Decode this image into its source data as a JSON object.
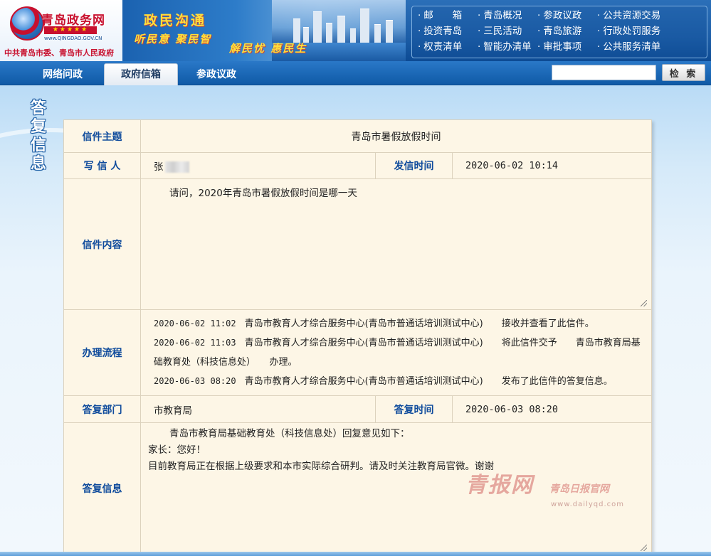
{
  "header": {
    "logo_title": "青岛政务网",
    "logo_stars": "★★★★★",
    "logo_domain": "www.QINGDAO.GOV.CN",
    "logo_subtitle": "中共青岛市委、青岛市人民政府",
    "slogan_main": "政民沟通",
    "slogan_line1": "听民意 聚民智",
    "slogan_line2": "解民忧 惠民生",
    "nav_links": [
      "邮　　箱",
      "青岛概况",
      "参政议政",
      "公共资源交易",
      "投资青岛",
      "三民活动",
      "青岛旅游",
      "行政处罚服务",
      "权责清单",
      "智能办清单",
      "审批事项",
      "公共服务清单"
    ]
  },
  "tabs": [
    {
      "label": "网络问政",
      "active": false
    },
    {
      "label": "政府信箱",
      "active": true
    },
    {
      "label": "参政议政",
      "active": false
    }
  ],
  "search": {
    "placeholder": "",
    "button_label": "检 索"
  },
  "side_title": [
    "答",
    "复",
    "信",
    "息"
  ],
  "letter": {
    "subject_label": "信件主题",
    "subject": "青岛市暑假放假时间",
    "author_label": "写 信 人",
    "author": "张",
    "sent_time_label": "发信时间",
    "sent_time": "2020-06-02 10:14",
    "content_label": "信件内容",
    "content": "请问，2020年青岛市暑假放假时间是哪一天",
    "process_label": "办理流程",
    "process": [
      {
        "time": "2020-06-02 11:02",
        "org": "青岛市教育人才综合服务中心(青岛市普通话培训测试中心)",
        "action": "接收并查看了此信件。"
      },
      {
        "time": "2020-06-02 11:03",
        "org": "青岛市教育人才综合服务中心(青岛市普通话培训测试中心)",
        "action": "将此信件交予　　青岛市教育局基础教育处（科技信息处）　　办理。"
      },
      {
        "time": "2020-06-03 08:20",
        "org": "青岛市教育人才综合服务中心(青岛市普通话培训测试中心)",
        "action": "发布了此信件的答复信息。"
      }
    ],
    "reply_dept_label": "答复部门",
    "reply_dept": "市教育局",
    "reply_time_label": "答复时间",
    "reply_time": "2020-06-03 08:20",
    "reply_label": "答复信息",
    "reply_lines": [
      "青岛市教育局基础教育处（科技信息处）回复意见如下：",
      "家长：您好！",
      "目前教育局正在根据上级要求和本市实际综合研判。请及时关注教育局官微。谢谢"
    ]
  },
  "watermark": {
    "main": "青报网",
    "side": "青岛日报官网",
    "url": "www.dailyqd.com"
  },
  "colors": {
    "header_blue": "#1c5ea8",
    "label_blue": "#0f4b9c",
    "table_bg": "#fdf6e6",
    "slogan_yellow": "#ffdf3b",
    "logo_red": "#c8102e"
  }
}
